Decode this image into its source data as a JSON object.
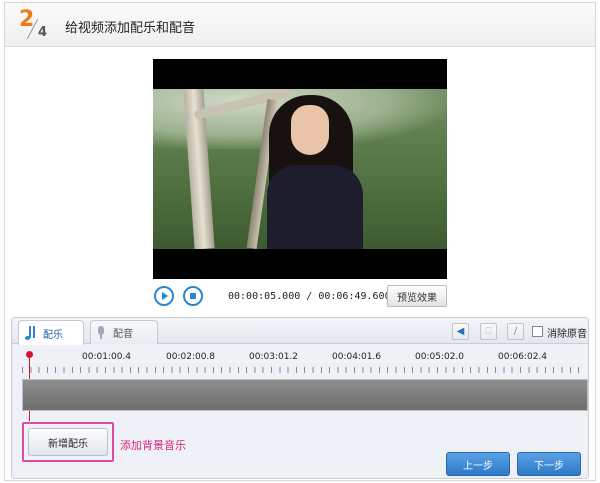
{
  "header": {
    "step_current": "2",
    "step_total": "4",
    "title": "给视频添加配乐和配音"
  },
  "player": {
    "time_current": "00:00:05.000",
    "time_separator": "/",
    "time_total": "00:06:49.600",
    "preview_label": "预览效果",
    "play_icon": "play-icon",
    "stop_icon": "stop-icon"
  },
  "tabs": [
    {
      "label": "配乐",
      "icon": "music-note-icon",
      "active": true
    },
    {
      "label": "配音",
      "icon": "microphone-icon",
      "active": false
    }
  ],
  "toolbar": {
    "mute_original_label": "消除原音",
    "tools": [
      "speaker-icon",
      "trash-icon",
      "broom-icon"
    ]
  },
  "timeline": {
    "ticks": [
      "00:01:00.4",
      "00:02:00.8",
      "00:03:01.2",
      "00:04:01.6",
      "00:05:02.0",
      "00:06:02.4"
    ]
  },
  "actions": {
    "add_music_label": "新增配乐",
    "add_music_hint": "添加背景音乐",
    "prev_label": "上一步",
    "next_label": "下一步"
  },
  "colors": {
    "accent": "#2a86d0",
    "step_orange": "#f07a1a",
    "hint_pink": "#d9287f",
    "marker_red": "#d0142b"
  }
}
